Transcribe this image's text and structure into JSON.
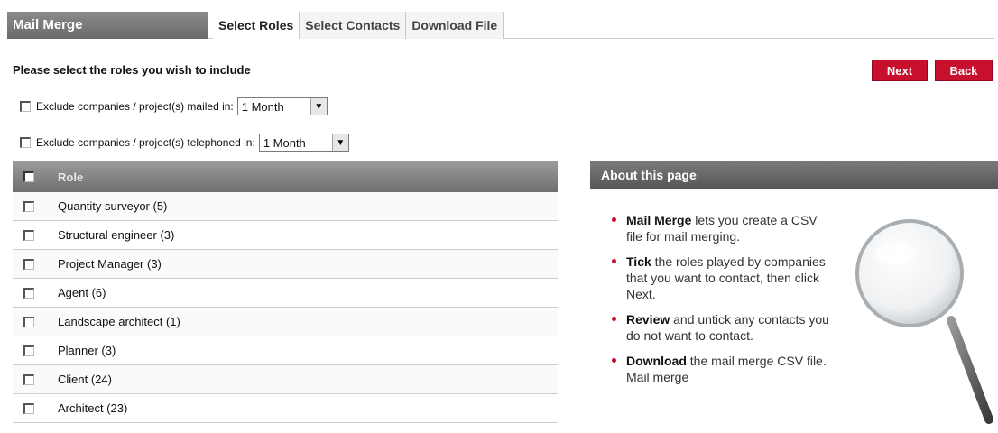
{
  "app": {
    "title": "Mail Merge"
  },
  "tabs": [
    {
      "label": "Select Roles",
      "active": true
    },
    {
      "label": "Select Contacts",
      "active": false
    },
    {
      "label": "Download File",
      "active": false
    }
  ],
  "prompt": "Please select the roles you wish to include",
  "buttons": {
    "next": "Next",
    "back": "Back"
  },
  "filters": {
    "mailed": {
      "label": "Exclude companies / project(s) mailed in:",
      "value": "1 Month",
      "checked": false
    },
    "telephoned": {
      "label": "Exclude companies / project(s) telephoned in:",
      "value": "1 Month",
      "checked": false
    }
  },
  "roles": {
    "header": "Role",
    "items": [
      "Quantity surveyor (5)",
      "Structural engineer (3)",
      "Project Manager (3)",
      "Agent (6)",
      "Landscape architect (1)",
      "Planner (3)",
      "Client (24)",
      "Architect (23)"
    ]
  },
  "about": {
    "title": "About this page",
    "items": [
      {
        "bold": "Mail Merge",
        "text": " lets you create a CSV file for mail merging."
      },
      {
        "bold": "Tick",
        "text": " the roles played by companies that you want to contact, then click Next."
      },
      {
        "bold": "Review",
        "text": " and untick any contacts you do not want to contact."
      },
      {
        "bold": "Download",
        "text": " the mail merge CSV file. Mail merge"
      }
    ]
  },
  "icons": {
    "magnifier": "magnifying-glass-icon",
    "dropdown": "chevron-down-icon"
  },
  "colors": {
    "accent": "#c8102e",
    "header_gray": "#6b6b6b",
    "background": "#e3edf6"
  }
}
